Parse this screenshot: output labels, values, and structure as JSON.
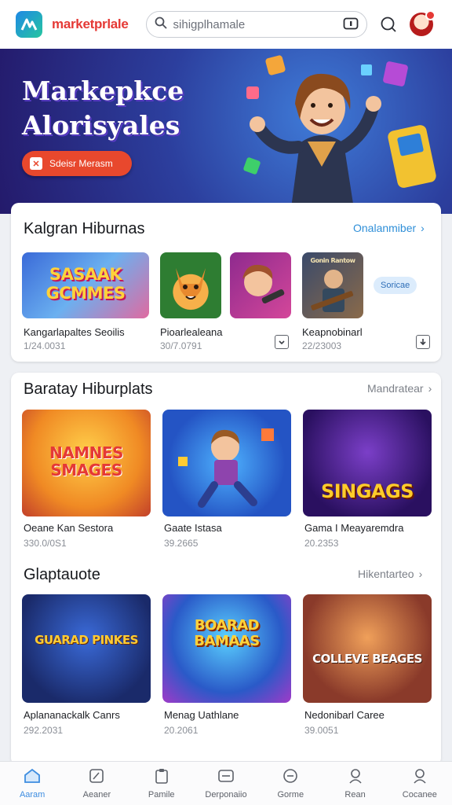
{
  "header": {
    "brand": "marketprlale",
    "search_placeholder": "sihigplhamale"
  },
  "banner": {
    "title_line1": "Markepkce",
    "title_line2": "Alorisyales",
    "button_label": "Sdeisr Merasm"
  },
  "section1": {
    "title": "Kalgran Hiburnas",
    "link": "Onalanmiber",
    "badge": "Soricae",
    "items": [
      {
        "thumb_text": "SASAAK GCMMES",
        "name": "Kangarlapaltes Seoilis",
        "meta": "1/24.0031"
      },
      {
        "name": "Pioarlealeana",
        "meta": "30/7.0791"
      },
      {
        "name": "Keapnobinarl",
        "meta": "22/23003",
        "thumb_text": "Gonin Rantow"
      }
    ]
  },
  "section2": {
    "title": "Baratay Hiburplats",
    "link": "Mandratear",
    "items": [
      {
        "thumb_text": "NAMNES SMAGES",
        "name": "Oeane Kan Sestora",
        "meta": "330.0/0S1"
      },
      {
        "name": "Gaate Istasa",
        "meta": "39.2665"
      },
      {
        "thumb_text": "SINGAGS",
        "name": "Gama I Meayaremdra",
        "meta": "20.2353"
      }
    ]
  },
  "section3": {
    "title": "Glaptauote",
    "link": "Hikentarteo",
    "items": [
      {
        "thumb_text": "GUARAD PINKES",
        "name": "Aplananackalk Canrs",
        "meta": "292.2031"
      },
      {
        "thumb_text": "BOARAD BAMAAS",
        "name": "Menag Uathlane",
        "meta": "20.2061"
      },
      {
        "thumb_text": "COLLEVE BEAGES",
        "name": "Nedonibarl Caree",
        "meta": "39.0051"
      }
    ]
  },
  "nav": [
    {
      "label": "Aaram",
      "icon": "home-icon"
    },
    {
      "label": "Aeaner",
      "icon": "edit-icon"
    },
    {
      "label": "Pamile",
      "icon": "clipboard-icon"
    },
    {
      "label": "Derponaiio",
      "icon": "card-icon"
    },
    {
      "label": "Gorme",
      "icon": "game-icon"
    },
    {
      "label": "Rean",
      "icon": "user-icon"
    },
    {
      "label": "Cocanee",
      "icon": "profile-icon"
    }
  ],
  "colors": {
    "brand": "#e53935",
    "link": "#2f8fd8",
    "accent": "#e8482d",
    "nav_active": "#3e8de0"
  }
}
